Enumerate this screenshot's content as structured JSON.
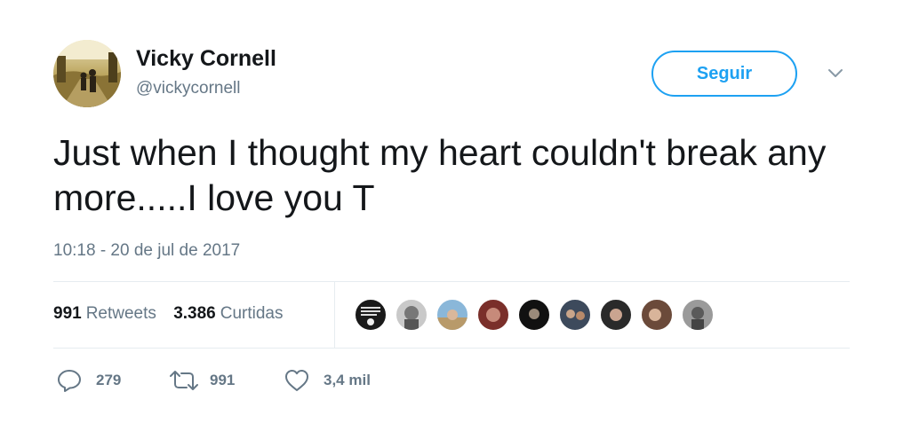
{
  "author": {
    "display_name": "Vicky Cornell",
    "handle": "@vickycornell"
  },
  "follow_button": {
    "label": "Seguir"
  },
  "tweet": {
    "text": "Just when I thought my heart couldn't break any more.....I love you T",
    "timestamp": "10:18 - 20 de jul de 2017"
  },
  "stats": {
    "retweets_count": "991",
    "retweets_label": "Retweets",
    "likes_count": "3.386",
    "likes_label": "Curtidas"
  },
  "actions": {
    "reply_count": "279",
    "retweet_count": "991",
    "like_count": "3,4 mil"
  },
  "icons": {
    "menu": "chevron-down-icon",
    "reply": "reply-icon",
    "retweet": "retweet-icon",
    "like": "heart-icon"
  },
  "colors": {
    "accent": "#1da1f2",
    "text": "#14171a",
    "secondary": "#657786",
    "divider": "#e6ecf0"
  }
}
